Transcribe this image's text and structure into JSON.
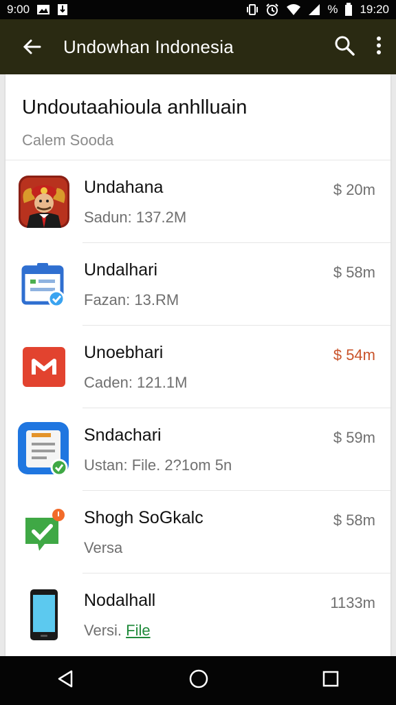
{
  "status_bar": {
    "time": "9:00",
    "battery_percent": "%",
    "clock_right": "19:20"
  },
  "app_bar": {
    "title": "Undowhan Indonesia"
  },
  "section": {
    "title": "Undoutaahioula anhlluain",
    "subtitle": "Calem Sooda"
  },
  "items": [
    {
      "name": "Undahana",
      "meta": "Sadun: 137.2M",
      "price": "$ 20m",
      "price_color": "#6f6f6f",
      "icon": "mascot-app-icon"
    },
    {
      "name": "Undalhari",
      "meta": "Fazan: 13.RM",
      "price": "$ 58m",
      "price_color": "#6f6f6f",
      "icon": "calendar-app-icon"
    },
    {
      "name": "Unoebhari",
      "meta": "Caden: 121.1M",
      "price": "$ 54m",
      "price_color": "#c9532a",
      "icon": "mail-app-icon"
    },
    {
      "name": "Sndachari",
      "meta": "Ustan: File. 2?1om 5n",
      "price": "$ 59m",
      "price_color": "#6f6f6f",
      "icon": "notes-app-icon"
    },
    {
      "name": "Shogh SoGkalc",
      "meta": "Versa",
      "price": "$ 58m",
      "price_color": "#6f6f6f",
      "icon": "chat-check-app-icon"
    },
    {
      "name": "Nodalhall",
      "meta_prefix": "Versi.",
      "meta_link": "File",
      "price": "1133m",
      "price_color": "#6f6f6f",
      "icon": "phone-app-icon"
    }
  ]
}
